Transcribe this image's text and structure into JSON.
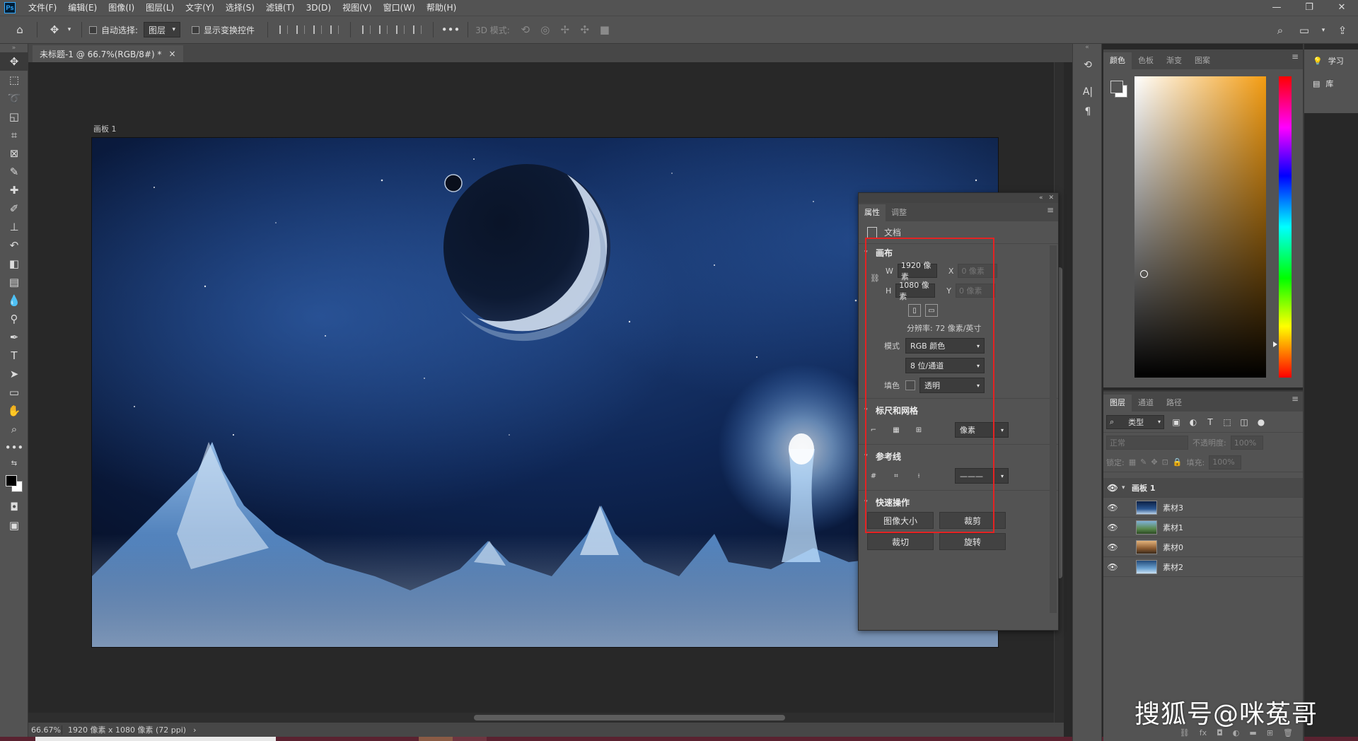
{
  "menubar": {
    "logo": "Ps",
    "items": [
      "文件(F)",
      "编辑(E)",
      "图像(I)",
      "图层(L)",
      "文字(Y)",
      "选择(S)",
      "滤镜(T)",
      "3D(D)",
      "视图(V)",
      "窗口(W)",
      "帮助(H)"
    ],
    "window_controls": [
      "—",
      "❐",
      "✕"
    ]
  },
  "optionsbar": {
    "auto_select_label": "自动选择:",
    "auto_select_value": "图层",
    "show_transform_label": "显示变换控件",
    "mode_3d_label": "3D 模式:"
  },
  "document": {
    "tab_title": "未标题-1 @ 66.7%(RGB/8#) *",
    "tab_close": "×",
    "artboard_label": "画板 1"
  },
  "statusbar": {
    "zoom": "66.67%",
    "info": "1920 像素 x 1080 像素 (72 ppi)",
    "arrow": "›"
  },
  "properties": {
    "tabs": [
      "属性",
      "调整"
    ],
    "doc_label": "文档",
    "canvas": {
      "title": "画布",
      "w_label": "W",
      "w_value": "1920 像素",
      "h_label": "H",
      "h_value": "1080 像素",
      "x_label": "X",
      "x_value": "0 像素",
      "y_label": "Y",
      "y_value": "0 像素",
      "resolution": "分辨率: 72 像素/英寸",
      "mode_label": "模式",
      "mode_value": "RGB 颜色",
      "depth_value": "8 位/通道",
      "fill_label": "填色",
      "fill_value": "透明"
    },
    "rulers": {
      "title": "标尺和网格",
      "unit_value": "像素"
    },
    "guides": {
      "title": "参考线",
      "line_value": "———"
    },
    "quick": {
      "title": "快速操作",
      "buttons": [
        "图像大小",
        "裁剪",
        "裁切",
        "旋转"
      ]
    }
  },
  "colorpanel": {
    "tabs": [
      "颜色",
      "色板",
      "渐变",
      "图案"
    ],
    "hue_color": "#f39c12"
  },
  "learn": {
    "items": [
      "学习",
      "库"
    ]
  },
  "layers": {
    "tabs": [
      "图层",
      "通道",
      "路径"
    ],
    "filter_value": "类型",
    "blend_value": "正常",
    "opacity_label": "不透明度:",
    "opacity_value": "100%",
    "lock_label": "锁定:",
    "fill_label": "填充:",
    "fill_value": "100%",
    "group_name": "画板 1",
    "items": [
      {
        "name": "素材3"
      },
      {
        "name": "素材1"
      },
      {
        "name": "素材0"
      },
      {
        "name": "素材2"
      }
    ]
  },
  "watermark": "搜狐号@咪菟哥"
}
